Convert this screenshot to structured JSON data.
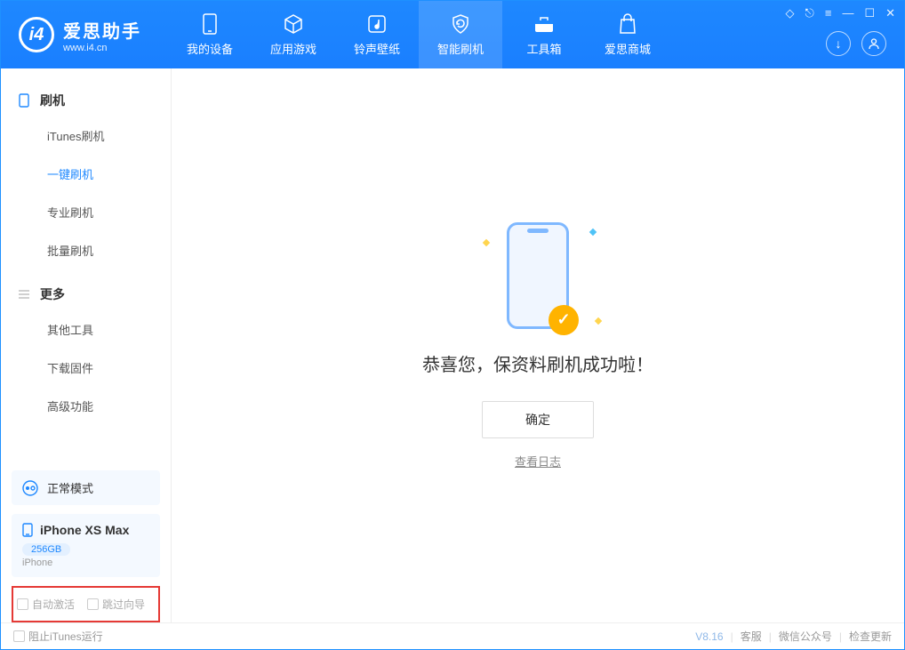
{
  "app": {
    "name": "爱思助手",
    "url": "www.i4.cn"
  },
  "tabs": [
    {
      "label": "我的设备"
    },
    {
      "label": "应用游戏"
    },
    {
      "label": "铃声壁纸"
    },
    {
      "label": "智能刷机"
    },
    {
      "label": "工具箱"
    },
    {
      "label": "爱思商城"
    }
  ],
  "sidebar": {
    "section1_title": "刷机",
    "items1": [
      {
        "label": "iTunes刷机"
      },
      {
        "label": "一键刷机"
      },
      {
        "label": "专业刷机"
      },
      {
        "label": "批量刷机"
      }
    ],
    "section2_title": "更多",
    "items2": [
      {
        "label": "其他工具"
      },
      {
        "label": "下载固件"
      },
      {
        "label": "高级功能"
      }
    ]
  },
  "status": {
    "mode": "正常模式"
  },
  "device": {
    "name": "iPhone XS Max",
    "storage": "256GB",
    "type": "iPhone"
  },
  "options": {
    "auto_activate": "自动激活",
    "skip_guide": "跳过向导"
  },
  "main": {
    "success_text": "恭喜您，保资料刷机成功啦！",
    "ok_button": "确定",
    "view_log": "查看日志"
  },
  "footer": {
    "block_itunes": "阻止iTunes运行",
    "version": "V8.16",
    "links": {
      "support": "客服",
      "wechat": "微信公众号",
      "update": "检查更新"
    }
  }
}
